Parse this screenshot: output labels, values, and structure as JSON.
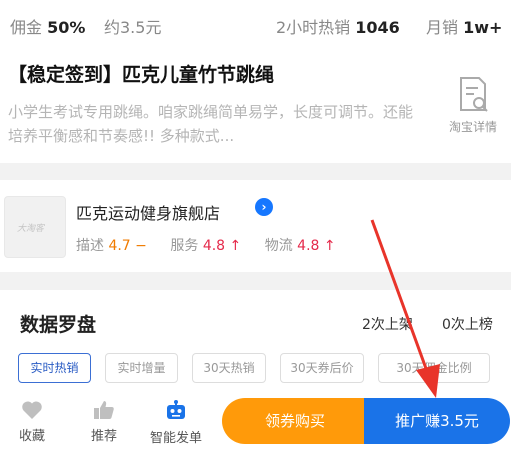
{
  "stats": {
    "commission_label": "佣金",
    "commission_value": "50%",
    "estimated_label": "约3.5元",
    "hot_sales_label": "2小时热销",
    "hot_sales_value": "1046",
    "monthly_sales_label": "月销",
    "monthly_sales_value": "1w+"
  },
  "product": {
    "title": "【稳定签到】匹克儿童竹节跳绳",
    "description": "小学生考试专用跳绳。咱家跳绳简单易学，长度可调节。还能培养平衡感和节奏感!! 多种款式...",
    "detail_link_label": "淘宝详情"
  },
  "shop": {
    "logo_text": "大淘客",
    "name": "匹克运动健身旗舰店",
    "verified_icon": "chevron-right-circle",
    "ratings": [
      {
        "label": "描述",
        "value": "4.7",
        "trend": "−",
        "color": "#f07b00"
      },
      {
        "label": "服务",
        "value": "4.8",
        "trend": "↑",
        "color": "#e52a4b"
      },
      {
        "label": "物流",
        "value": "4.8",
        "trend": "↑",
        "color": "#e52a4b"
      }
    ]
  },
  "data_compass": {
    "title": "数据罗盘",
    "stat_a": "2次上架",
    "stat_b": "0次上榜",
    "chips": [
      {
        "label": "实时热销",
        "active": true
      },
      {
        "label": "实时增量",
        "active": false
      },
      {
        "label": "30天热销",
        "active": false
      },
      {
        "label": "30天券后价",
        "active": false
      },
      {
        "label": "30天佣金比例",
        "active": false
      }
    ]
  },
  "bottom_bar": {
    "favorite_label": "收藏",
    "recommend_label": "推荐",
    "smart_post_label": "智能发单",
    "coupon_buy_label": "领券购买",
    "promote_label": "推广赚3.5元"
  },
  "colors": {
    "accent_blue": "#1a73e8",
    "accent_orange": "#ff9a0a",
    "annotation_red": "#e8342a"
  }
}
